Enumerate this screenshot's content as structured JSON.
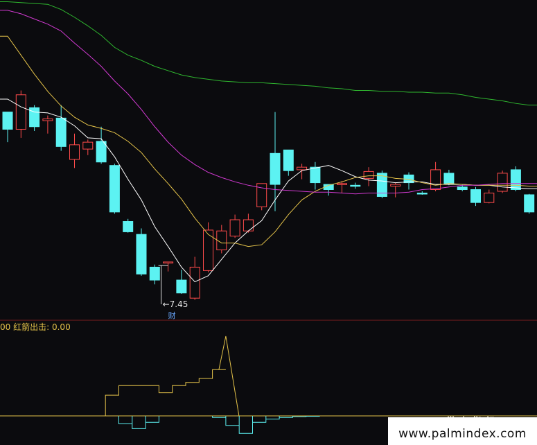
{
  "chart_data": {
    "type": "candlestick",
    "price_range": [
      6.9,
      10.6
    ],
    "candles": [
      {
        "o": 9.1,
        "h": 9.3,
        "l": 8.95,
        "c": 9.3,
        "up": false
      },
      {
        "o": 9.1,
        "h": 9.55,
        "l": 9.0,
        "c": 9.5,
        "up": true
      },
      {
        "o": 9.35,
        "h": 9.38,
        "l": 9.08,
        "c": 9.13,
        "up": false
      },
      {
        "o": 9.2,
        "h": 9.26,
        "l": 9.05,
        "c": 9.22,
        "up": true
      },
      {
        "o": 9.23,
        "h": 9.38,
        "l": 8.85,
        "c": 8.9,
        "up": false
      },
      {
        "o": 8.75,
        "h": 9.05,
        "l": 8.65,
        "c": 8.92,
        "up": true
      },
      {
        "o": 8.87,
        "h": 8.98,
        "l": 8.8,
        "c": 8.95,
        "up": true
      },
      {
        "o": 8.96,
        "h": 9.13,
        "l": 8.7,
        "c": 8.72,
        "up": false
      },
      {
        "o": 8.68,
        "h": 8.7,
        "l": 8.12,
        "c": 8.14,
        "up": false
      },
      {
        "o": 8.03,
        "h": 8.06,
        "l": 7.9,
        "c": 7.91,
        "up": false
      },
      {
        "o": 7.88,
        "h": 7.95,
        "l": 7.4,
        "c": 7.42,
        "up": false
      },
      {
        "o": 7.5,
        "h": 7.53,
        "l": 7.3,
        "c": 7.35,
        "up": false
      },
      {
        "o": 7.56,
        "h": 7.56,
        "l": 7.45,
        "c": 7.56,
        "up": true
      },
      {
        "o": 7.35,
        "h": 7.47,
        "l": 7.19,
        "c": 7.2,
        "up": false
      },
      {
        "o": 7.14,
        "h": 7.62,
        "l": 7.12,
        "c": 7.5,
        "up": true
      },
      {
        "o": 7.46,
        "h": 8.02,
        "l": 7.44,
        "c": 7.93,
        "up": true
      },
      {
        "o": 7.7,
        "h": 7.99,
        "l": 7.66,
        "c": 7.92,
        "up": true
      },
      {
        "o": 7.86,
        "h": 8.11,
        "l": 7.84,
        "c": 8.05,
        "up": true
      },
      {
        "o": 7.92,
        "h": 8.12,
        "l": 7.9,
        "c": 8.05,
        "up": true
      },
      {
        "o": 8.2,
        "h": 8.46,
        "l": 8.16,
        "c": 8.47,
        "up": true
      },
      {
        "o": 8.46,
        "h": 9.3,
        "l": 8.15,
        "c": 8.82,
        "up": false
      },
      {
        "o": 8.86,
        "h": 8.86,
        "l": 8.56,
        "c": 8.62,
        "up": false
      },
      {
        "o": 8.63,
        "h": 8.7,
        "l": 8.52,
        "c": 8.66,
        "up": true
      },
      {
        "o": 8.66,
        "h": 8.72,
        "l": 8.4,
        "c": 8.48,
        "up": false
      },
      {
        "o": 8.4,
        "h": 8.46,
        "l": 8.33,
        "c": 8.46,
        "up": false
      },
      {
        "o": 8.47,
        "h": 8.5,
        "l": 8.36,
        "c": 8.46,
        "up": true
      },
      {
        "o": 8.44,
        "h": 8.48,
        "l": 8.41,
        "c": 8.45,
        "up": false
      },
      {
        "o": 8.53,
        "h": 8.66,
        "l": 8.44,
        "c": 8.61,
        "up": true
      },
      {
        "o": 8.59,
        "h": 8.62,
        "l": 8.3,
        "c": 8.32,
        "up": false
      },
      {
        "o": 8.44,
        "h": 8.48,
        "l": 8.31,
        "c": 8.46,
        "up": true
      },
      {
        "o": 8.57,
        "h": 8.6,
        "l": 8.4,
        "c": 8.48,
        "up": false
      },
      {
        "o": 8.35,
        "h": 8.38,
        "l": 8.34,
        "c": 8.36,
        "up": false
      },
      {
        "o": 8.4,
        "h": 8.72,
        "l": 8.38,
        "c": 8.63,
        "up": true
      },
      {
        "o": 8.59,
        "h": 8.63,
        "l": 8.45,
        "c": 8.47,
        "up": false
      },
      {
        "o": 8.43,
        "h": 8.46,
        "l": 8.38,
        "c": 8.4,
        "up": false
      },
      {
        "o": 8.4,
        "h": 8.43,
        "l": 8.21,
        "c": 8.25,
        "up": false
      },
      {
        "o": 8.25,
        "h": 8.4,
        "l": 8.24,
        "c": 8.36,
        "up": true
      },
      {
        "o": 8.38,
        "h": 8.62,
        "l": 8.36,
        "c": 8.59,
        "up": true
      },
      {
        "o": 8.63,
        "h": 8.67,
        "l": 8.38,
        "c": 8.4,
        "up": false
      },
      {
        "o": 8.34,
        "h": 8.35,
        "l": 8.12,
        "c": 8.14,
        "up": false
      }
    ],
    "ma_series": [
      {
        "color": "#ffffff",
        "values": [
          9.45,
          9.36,
          9.3,
          9.29,
          9.24,
          9.14,
          9.0,
          8.99,
          8.78,
          8.52,
          8.28,
          7.97,
          7.74,
          7.5,
          7.33,
          7.4,
          7.59,
          7.78,
          7.92,
          8.04,
          8.28,
          8.5,
          8.62,
          8.65,
          8.68,
          8.62,
          8.55,
          8.51,
          8.5,
          8.48,
          8.49,
          8.49,
          8.46,
          8.46,
          8.46,
          8.45,
          8.45,
          8.43,
          8.42,
          8.41
        ]
      },
      {
        "color": "#e6c44a",
        "values": [
          10.18,
          9.96,
          9.74,
          9.54,
          9.37,
          9.24,
          9.15,
          9.11,
          9.06,
          8.96,
          8.83,
          8.64,
          8.47,
          8.29,
          8.07,
          7.88,
          7.78,
          7.78,
          7.74,
          7.76,
          7.91,
          8.11,
          8.28,
          8.38,
          8.45,
          8.49,
          8.54,
          8.56,
          8.56,
          8.53,
          8.52,
          8.48,
          8.45,
          8.47,
          8.46,
          8.45,
          8.45,
          8.45,
          8.45,
          8.44
        ]
      },
      {
        "color": "#d23ad2",
        "values": [
          10.48,
          10.44,
          10.38,
          10.32,
          10.24,
          10.1,
          9.97,
          9.83,
          9.66,
          9.51,
          9.33,
          9.13,
          8.95,
          8.8,
          8.69,
          8.6,
          8.54,
          8.49,
          8.45,
          8.42,
          8.4,
          8.39,
          8.38,
          8.37,
          8.37,
          8.36,
          8.35,
          8.36,
          8.36,
          8.36,
          8.37,
          8.4,
          8.41,
          8.43,
          8.45,
          8.45,
          8.46,
          8.47,
          8.47,
          8.47
        ]
      },
      {
        "color": "#2fb82f",
        "values": [
          10.58,
          10.57,
          10.56,
          10.55,
          10.49,
          10.4,
          10.3,
          10.19,
          10.05,
          9.96,
          9.9,
          9.83,
          9.78,
          9.73,
          9.7,
          9.68,
          9.66,
          9.65,
          9.64,
          9.64,
          9.63,
          9.62,
          9.61,
          9.6,
          9.58,
          9.57,
          9.55,
          9.55,
          9.54,
          9.54,
          9.53,
          9.53,
          9.52,
          9.52,
          9.5,
          9.47,
          9.45,
          9.43,
          9.4,
          9.38
        ]
      }
    ],
    "low_marker": {
      "index": 12,
      "price": 7.45,
      "label": "7.45",
      "tag": "财"
    },
    "indicator": {
      "name": "红箭出击",
      "prefix": "00",
      "value_label": "0.00",
      "yellow_steps": [
        0,
        0,
        0,
        0,
        0.26,
        0.38,
        0.38,
        0.38,
        0.29,
        0.38,
        0.42,
        0.47,
        0.58,
        1.0,
        0.0,
        0,
        0,
        0,
        0,
        0
      ],
      "cyan_steps": [
        0,
        0,
        0,
        0,
        0,
        -0.1,
        -0.16,
        -0.08,
        0,
        0,
        0,
        0,
        -0.02,
        -0.12,
        -0.22,
        -0.08,
        -0.04,
        -0.02,
        -0.01,
        -0.005
      ]
    }
  },
  "watermark": {
    "cn": "掌上指标",
    "url": "www.palmindex.com"
  }
}
